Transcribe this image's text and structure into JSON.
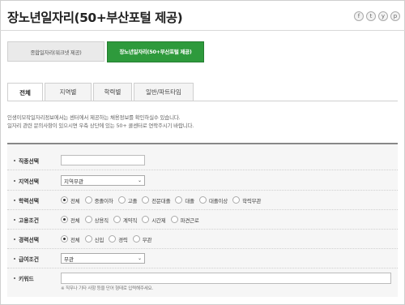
{
  "page_title": "장노년일자리(50+부산포털 제공)",
  "social": [
    "f",
    "t",
    "y",
    "p"
  ],
  "buttons": {
    "worknet": "종합일자리(워크넷 제공)",
    "busan": "장노년일자리(50+부산포털 제공)"
  },
  "tabs": [
    {
      "label": "전체",
      "active": true
    },
    {
      "label": "지역별",
      "active": false
    },
    {
      "label": "학력별",
      "active": false
    },
    {
      "label": "일반/파트타임",
      "active": false
    }
  ],
  "description": [
    "인생이모작일자리정보에서는 센터에서 제공하는 채용정보를 확인하실수 있습니다.",
    "일자리 관련 문의사항이 있으시면 우측 상단에 있는 50+ 콜센터로 연락주시기 바랍니다."
  ],
  "form": {
    "job": {
      "label": "직종선택",
      "value": ""
    },
    "region": {
      "label": "지역선택",
      "selected": "지역무관"
    },
    "education": {
      "label": "학력선택",
      "options": [
        "전체",
        "중졸이하",
        "고졸",
        "전문대졸",
        "대졸",
        "대졸이상",
        "학력무관"
      ],
      "selected": "전체"
    },
    "employment": {
      "label": "고용조건",
      "options": [
        "전체",
        "상용직",
        "계약직",
        "시간제",
        "파견근로"
      ],
      "selected": "전체"
    },
    "career": {
      "label": "경력선택",
      "options": [
        "전체",
        "신입",
        "경력",
        "무관"
      ],
      "selected": "전체"
    },
    "salary": {
      "label": "급여조건",
      "selected": "무관"
    },
    "keyword": {
      "label": "키워드",
      "value": "",
      "note": "※ 직무나 기타 사항 등을 단어 형태로 입력해주세요."
    }
  }
}
